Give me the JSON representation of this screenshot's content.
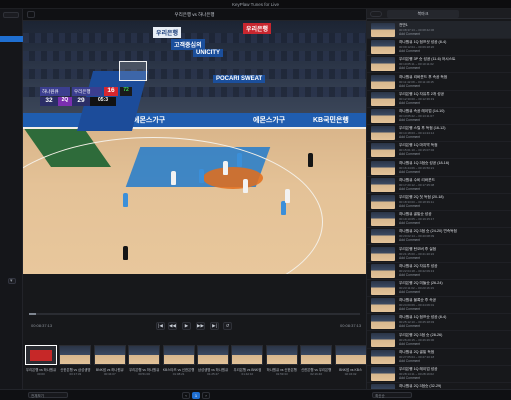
{
  "window": {
    "title": "KeyPlaw Tunes for Live"
  },
  "main": {
    "video_title": "우리은행 vs 하나은행",
    "time_current": "00:08:37:13",
    "time_total": "00:08:37:13",
    "progress_fraction": 0.02
  },
  "scoreboard": {
    "team_left": "하나원큐",
    "team_right": "우리은행",
    "score_left": "32",
    "score_right": "29",
    "quarter": "2Q",
    "shot_clock": "16",
    "game_clock": "05:3",
    "shot_clock_side": "72"
  },
  "arena": {
    "banner_1": "고객중심의",
    "banner_2": "UNICITY",
    "banner_3": "KB국민은행",
    "banner_4": "에몬스가구",
    "banner_5": "에몬스가구",
    "banner_6": "POCARI SWEAT",
    "banner_7": "우리은행",
    "banner_8": "우리은행"
  },
  "timeline": [
    {
      "label": "우리은행 vs 하나원큐",
      "ts": "00:00"
    },
    {
      "label": "신한은행 vs 삼성생명",
      "ts": "00:17:33"
    },
    {
      "label": "BNK썸 vs 하나원큐",
      "ts": "00:34:07"
    },
    {
      "label": "우리은행 vs 하나원큐",
      "ts": "00:51:00"
    },
    {
      "label": "KB스타즈 vs 신한은행",
      "ts": "01:08:21"
    },
    {
      "label": "삼성생명 vs 하나원큐",
      "ts": "01:25:47"
    },
    {
      "label": "우리은행 vs BNK썸",
      "ts": "01:42:10"
    },
    {
      "label": "하나원큐 vs 신한은행",
      "ts": "01:59:33"
    },
    {
      "label": "신한은행 vs 우리은행",
      "ts": "02:16:40"
    },
    {
      "label": "BNK썸 vs KB스",
      "ts": "02:34:02"
    }
  ],
  "bottom": {
    "left_select": "전체보기",
    "right_select": "최신순",
    "page_prev": "‹",
    "page_current": "1",
    "page_next": "›"
  },
  "right_panel": {
    "tab_label": "북마크",
    "clips": [
      {
        "title": "전반1",
        "meta": "00:08:37:13 ~ 00:08:42:06",
        "add": "Add Comment"
      },
      {
        "title": "하나원큐 1Q 점프샷 성공 (8-4)",
        "meta": "00:09:12:04 ~ 00:09:18:20",
        "add": "Add Comment"
      },
      {
        "title": "우리은행 3P 슛 성공 (11-6) 어시스트",
        "meta": "00:10:05:11 ~ 00:10:11:02",
        "add": "Add Comment"
      },
      {
        "title": "하나원큐 리바운드 후 속공 득점",
        "meta": "00:11:42:08 ~ 00:11:49:15",
        "add": "Add Comment"
      },
      {
        "title": "우리은행 1Q 자유투 2개 성공",
        "meta": "00:12:30:00 ~ 00:12:36:19",
        "add": "Add Comment"
      },
      {
        "title": "하나원큐 속공 레이업 (14-10)",
        "meta": "00:13:05:22 ~ 00:13:11:07",
        "add": "Add Comment"
      },
      {
        "title": "우리은행 스틸 후 득점 (16-12)",
        "meta": "00:14:18:03 ~ 00:14:24:14",
        "add": "Add Comment"
      },
      {
        "title": "우리은행 1Q 마지막 득점",
        "meta": "00:15:01:10 ~ 00:15:07:02",
        "add": "Add Comment"
      },
      {
        "title": "하나원큐 1Q 3점슛 성공 (18-16)",
        "meta": "00:16:44:06 ~ 00:16:50:21",
        "add": "Add Comment"
      },
      {
        "title": "하나원큐 수비 리바운드",
        "meta": "00:17:20:12 ~ 00:17:25:08",
        "add": "Add Comment"
      },
      {
        "title": "우리은행 2Q 첫 득점 (20-18)",
        "meta": "00:18:33:00 ~ 00:18:39:11",
        "add": "Add Comment"
      },
      {
        "title": "하나원큐 골밑슛 성공",
        "meta": "00:19:10:05 ~ 00:19:15:17",
        "add": "Add Comment"
      },
      {
        "title": "하나원큐 2Q 3점 슛 (24-20) 연속득점",
        "meta": "00:20:02:14 ~ 00:20:08:09",
        "add": "Add Comment"
      },
      {
        "title": "우리은행 턴오버 후 실점",
        "meta": "00:21:15:00 ~ 00:21:20:22",
        "add": "Add Comment"
      },
      {
        "title": "하나원큐 2Q 자유투 성공",
        "meta": "00:22:04:18 ~ 00:22:09:13",
        "add": "Add Comment"
      },
      {
        "title": "우리은행 2Q 미들슛 (26-24)",
        "meta": "00:23:11:02 ~ 00:23:16:19",
        "add": "Add Comment"
      },
      {
        "title": "하나원큐 블록슛 후 속공",
        "meta": "00:24:00:09 ~ 00:24:06:01",
        "add": "Add Comment"
      },
      {
        "title": "하나원큐 1Q 점프슛 성공 (8-4)",
        "meta": "00:25:12:10 ~ 00:25:18:03",
        "add": "Add Comment"
      },
      {
        "title": "우리은행 2Q 3점 슛 (28-26)",
        "meta": "00:26:20:15 ~ 00:26:26:00",
        "add": "Add Comment"
      },
      {
        "title": "하나원큐 2Q 골밑 득점",
        "meta": "00:27:05:04 ~ 00:27:10:18",
        "add": "Add Comment"
      },
      {
        "title": "우리은행 1Q 레이업 성공",
        "meta": "00:28:14:11 ~ 00:28:19:02",
        "add": "Add Comment"
      },
      {
        "title": "하나원큐 2Q 3점슛 (32-29)",
        "meta": "00:29:01:20 ~ 00:29:07:14",
        "add": "Add Comment"
      }
    ]
  }
}
